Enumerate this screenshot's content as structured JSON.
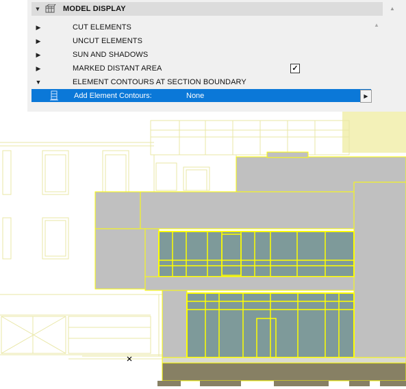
{
  "panel": {
    "title": "MODEL DISPLAY",
    "header_icon": "model-display-icon",
    "items": [
      {
        "label": "CUT ELEMENTS",
        "expanded": false
      },
      {
        "label": "UNCUT ELEMENTS",
        "expanded": false
      },
      {
        "label": "SUN AND SHADOWS",
        "expanded": false
      },
      {
        "label": "MARKED DISTANT AREA",
        "expanded": false,
        "checked": true
      },
      {
        "label": "ELEMENT CONTOURS AT SECTION BOUNDARY",
        "expanded": true
      }
    ],
    "selected_row": {
      "label": "Add Element Contours:",
      "value": "None",
      "icon": "element-contours-icon"
    }
  },
  "canvas": {
    "description_icon": "cursor-x-icon",
    "colors": {
      "wall_fill": "#c0c0c0",
      "contour": "#ffff00",
      "glass": "#7e9a9a",
      "ground": "#878064",
      "hatch_bg": "#f3f1b8"
    }
  }
}
